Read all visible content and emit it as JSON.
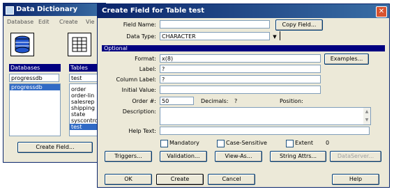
{
  "bg_window": {
    "title": "Data Dictionary",
    "menu": [
      "Database",
      "Edit",
      "Create",
      "Vie"
    ],
    "databases_label": "Databases",
    "databases_value": "progressdb",
    "databases_list": [
      "progressdb"
    ],
    "tables_label": "Tables",
    "tables_value": "test",
    "tables_list": [
      "order",
      "order-lin",
      "salesrep",
      "shipping",
      "state",
      "syscontro",
      "test"
    ],
    "create_field_button": "Create Field..."
  },
  "dialog": {
    "title": "Create Field for Table test",
    "field_name_label": "Field Name:",
    "field_name_value": "",
    "copy_field_button": "Copy Field...",
    "data_type_label": "Data Type:",
    "data_type_value": "CHARACTER",
    "optional_header": "Optional",
    "format_label": "Format:",
    "format_value": "x(8)",
    "examples_button": "Examples...",
    "label_label": "Label:",
    "label_value": "?",
    "column_label_label": "Column Label:",
    "column_label_value": "?",
    "initial_value_label": "Initial Value:",
    "initial_value_value": "",
    "order_label": "Order #:",
    "order_value": "50",
    "decimals_label": "Decimals:",
    "decimals_value": "?",
    "position_label": "Position:",
    "description_label": "Description:",
    "help_text_label": "Help Text:",
    "mandatory_label": "Mandatory",
    "case_sensitive_label": "Case-Sensitive",
    "extent_label": "Extent",
    "extent_value": "0",
    "triggers_button": "Triggers...",
    "validation_button": "Validation...",
    "view_as_button": "View-As...",
    "string_attrs_button": "String Attrs...",
    "dataserver_button": "DataServer...",
    "ok_button": "OK",
    "create_button": "Create",
    "cancel_button": "Cancel",
    "help_button": "Help"
  },
  "colors": {
    "title_start": "#0a246a",
    "title_end": "#3a6ea5",
    "dialog_bg": "#ece9d8",
    "optional_bar": "#000080",
    "selected": "#316ac5",
    "close_button": "#d8532f"
  }
}
